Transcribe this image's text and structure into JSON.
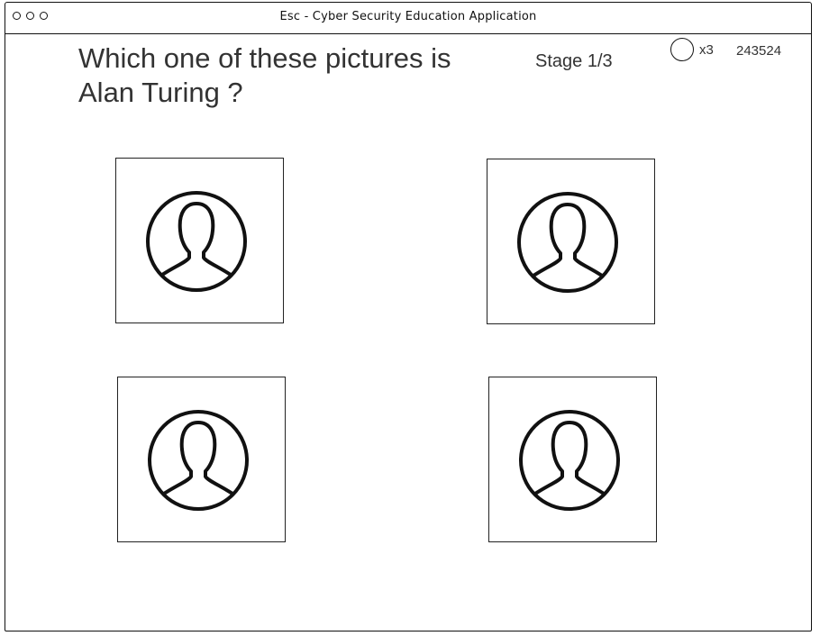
{
  "window": {
    "title": "Esc - Cyber Security Education Application"
  },
  "quiz": {
    "question": "Which one of these pictures is Alan Turing ?",
    "stage": "Stage 1/3",
    "lives": "x3",
    "score": "243524"
  },
  "pictures": [
    {
      "icon": "user-avatar-icon"
    },
    {
      "icon": "user-avatar-icon"
    },
    {
      "icon": "user-avatar-icon"
    },
    {
      "icon": "user-avatar-icon"
    }
  ]
}
